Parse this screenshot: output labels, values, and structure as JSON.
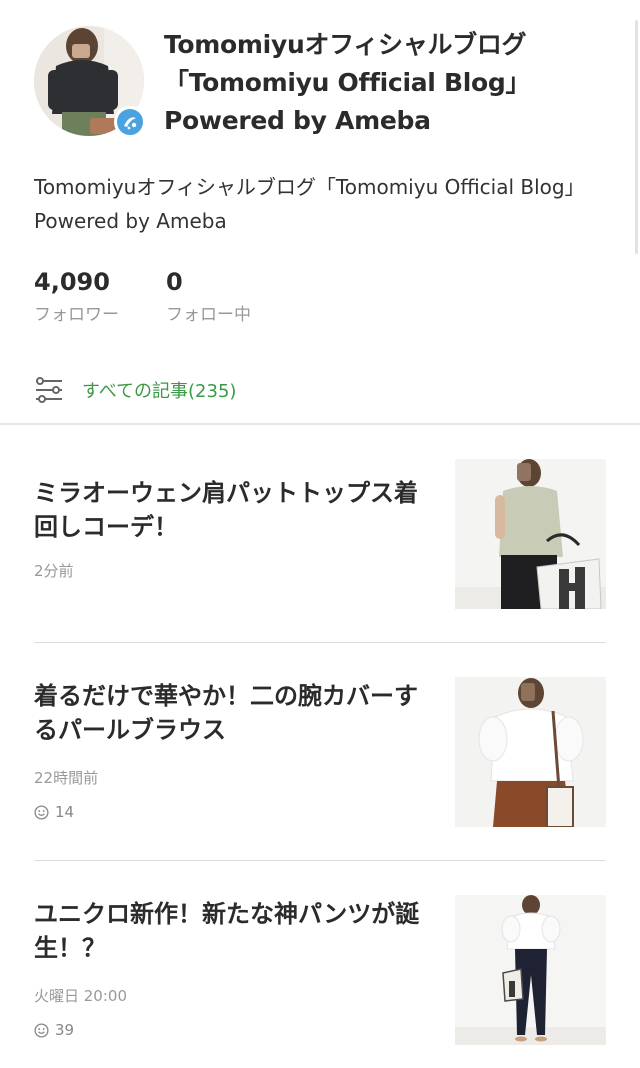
{
  "blog": {
    "title_line1": "Tomomiyuオフィシャルブログ",
    "title_line2": "「Tomomiyu Official Blog」",
    "title_line3": "Powered by Ameba",
    "description": "Tomomiyuオフィシャルブログ「Tomomiyu Official Blog」 Powered by Ameba",
    "badge_icon": "official-blogger-icon"
  },
  "stats": {
    "followers_count": "4,090",
    "followers_label": "フォロワー",
    "following_count": "0",
    "following_label": "フォロー中"
  },
  "all_articles": {
    "label": "すべての記事(235)",
    "icon": "list-settings-icon",
    "color": "#3b9a47"
  },
  "articles": [
    {
      "title": "ミラオーウェン肩パットトップス着回しコーデ！",
      "date": "2分前",
      "likes": null,
      "thumb_desc": "woman in sleeveless sage top with white tote"
    },
    {
      "title": "着るだけで華やか！二の腕カバーするパールブラウス",
      "date": "22時間前",
      "likes": "14",
      "thumb_desc": "woman in white blouse and brown pants"
    },
    {
      "title": "ユニクロ新作！新たな神パンツが誕生！？",
      "date": "火曜日 20:00",
      "likes": "39",
      "thumb_desc": "woman in white top and navy pants"
    }
  ]
}
